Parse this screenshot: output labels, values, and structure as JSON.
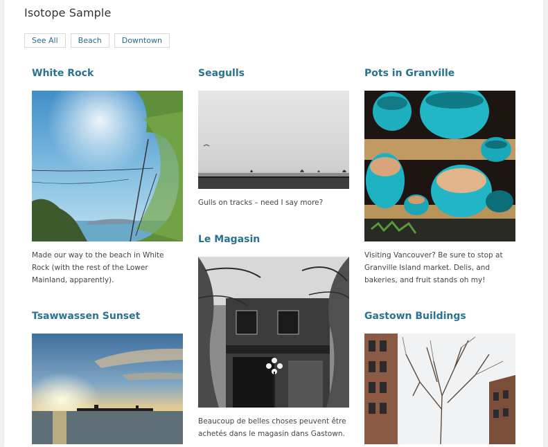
{
  "page": {
    "title": "Isotope Sample",
    "filters": [
      "See All",
      "Beach",
      "Downtown"
    ]
  },
  "cards": {
    "white_rock": {
      "title": "White Rock",
      "caption": "Made our way to the beach in White Rock (with the rest of the Lower Mainland, apparently)."
    },
    "seagulls": {
      "title": "Seagulls",
      "caption": "Gulls on tracks – need I say more?"
    },
    "pots": {
      "title": "Pots in Granville",
      "caption": "Visiting Vancouver? Be sure to stop at Granville Island market. Delis, and bakeries, and fruit stands oh my!"
    },
    "le_magasin": {
      "title": "Le Magasin",
      "caption": "Beaucoup de belles choses peuvent être achetés dans le magasin dans Gastown."
    },
    "tsawwassen": {
      "title": "Tsawwassen Sunset",
      "caption": ""
    },
    "gastown": {
      "title": "Gastown Buildings",
      "caption": ""
    }
  },
  "colors": {
    "link": "#287392",
    "text": "#444444"
  }
}
